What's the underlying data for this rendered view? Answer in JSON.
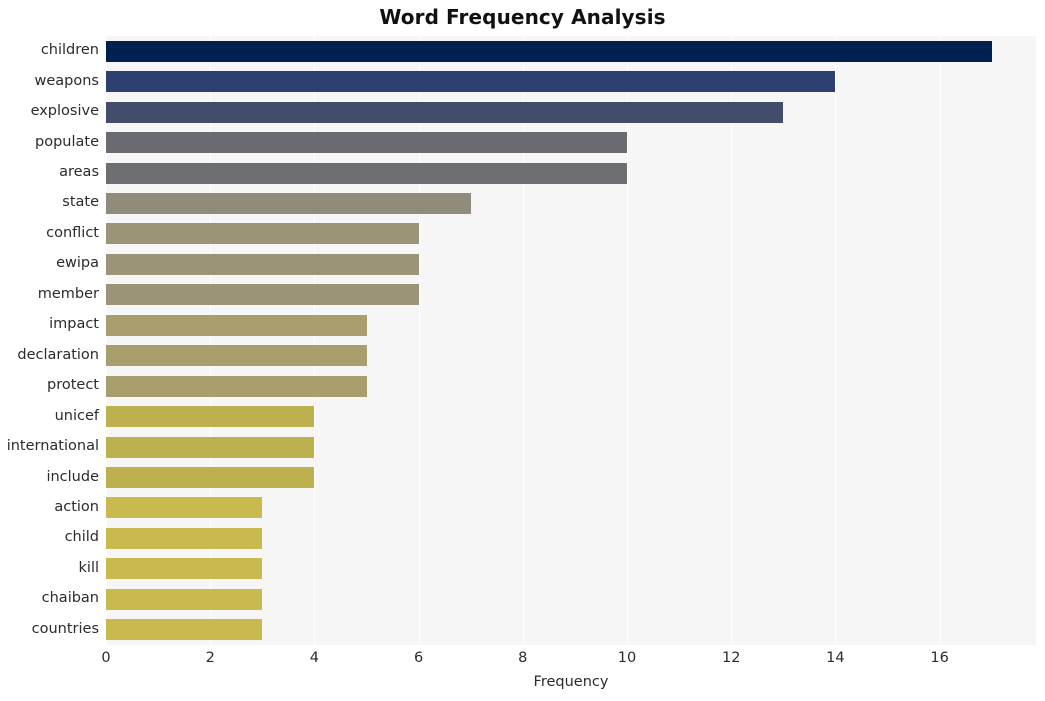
{
  "chart_data": {
    "type": "bar",
    "orientation": "horizontal",
    "title": "Word Frequency Analysis",
    "xlabel": "Frequency",
    "ylabel": "",
    "xlim": [
      0,
      17.85
    ],
    "xticks": [
      0,
      2,
      4,
      6,
      8,
      10,
      12,
      14,
      16
    ],
    "xticklabels": [
      "0",
      "2",
      "4",
      "6",
      "8",
      "10",
      "12",
      "14",
      "16"
    ],
    "grid": "vertical-only",
    "legend": "none",
    "categories": [
      "children",
      "weapons",
      "explosive",
      "populate",
      "areas",
      "state",
      "conflict",
      "ewipa",
      "member",
      "impact",
      "declaration",
      "protect",
      "unicef",
      "international",
      "include",
      "action",
      "child",
      "kill",
      "chaiban",
      "countries"
    ],
    "values": [
      17,
      14,
      13,
      10,
      10,
      7,
      6,
      6,
      6,
      5,
      5,
      5,
      4,
      4,
      4,
      3,
      3,
      3,
      3,
      3
    ],
    "colormap": "cividis",
    "bar_colors": [
      "#002052",
      "#2e4071",
      "#414d6b",
      "#6a6b71",
      "#6d6e72",
      "#918b7c",
      "#9b9477",
      "#9b9477",
      "#9b9477",
      "#a99e6e",
      "#a99e6e",
      "#a99e6e",
      "#bdb04f",
      "#bdb04f",
      "#bdb04f",
      "#c9ba4f",
      "#c9ba4f",
      "#c9ba4f",
      "#c9ba4f",
      "#c9ba4f"
    ],
    "plot_background": "#f6f6f7",
    "gridline_color": "#ffffff",
    "figure_background": "#ffffff"
  }
}
